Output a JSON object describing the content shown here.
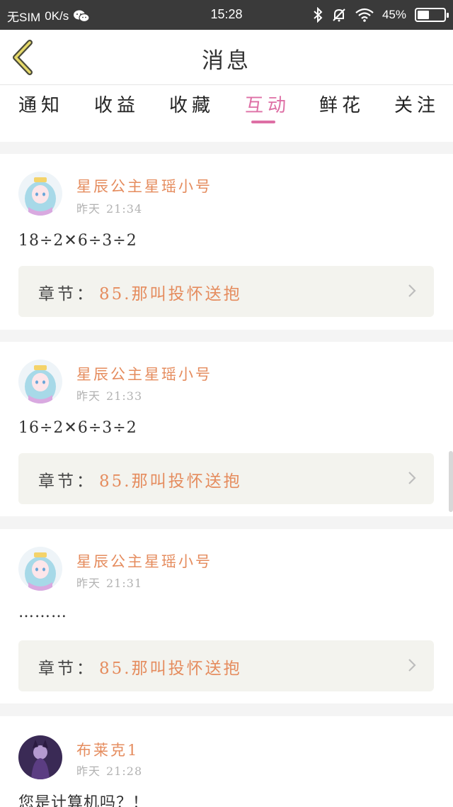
{
  "status_bar": {
    "carrier": "无SIM",
    "speed": "0K/s",
    "time": "15:28",
    "battery": "45%",
    "battery_level": 0.45
  },
  "nav": {
    "title": "消息"
  },
  "tabs": [
    {
      "label": "通知",
      "active": false
    },
    {
      "label": "收益",
      "active": false
    },
    {
      "label": "收藏",
      "active": false
    },
    {
      "label": "互动",
      "active": true
    },
    {
      "label": "鲜花",
      "active": false
    },
    {
      "label": "关注",
      "active": false
    }
  ],
  "messages": [
    {
      "username": "星辰公主星瑶小号",
      "day": "昨天",
      "time": "21:34",
      "content": "18÷2✕6÷3÷2",
      "chapter_label": "章节：",
      "chapter": "85.那叫投怀送抱"
    },
    {
      "username": "星辰公主星瑶小号",
      "day": "昨天",
      "time": "21:33",
      "content": "16÷2✕6÷3÷2",
      "chapter_label": "章节：",
      "chapter": "85.那叫投怀送抱"
    },
    {
      "username": "星辰公主星瑶小号",
      "day": "昨天",
      "time": "21:31",
      "content": "………",
      "chapter_label": "章节：",
      "chapter": "85.那叫投怀送抱"
    },
    {
      "username": "布莱克1",
      "day": "昨天",
      "time": "21:28",
      "content": "您是计算机吗？！"
    }
  ],
  "colors": {
    "accent_pink": "#de6fa5",
    "username_orange": "#e58c5e",
    "status_bar": "#3a3a3a"
  }
}
